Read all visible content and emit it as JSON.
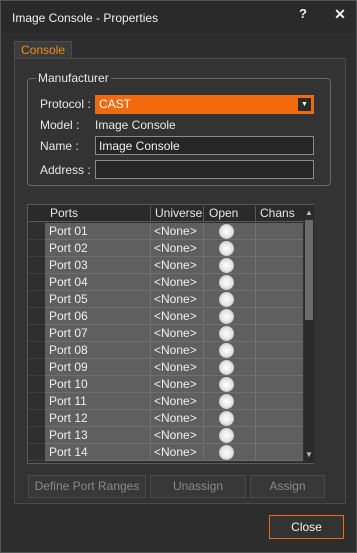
{
  "window": {
    "title": "Image Console - Properties",
    "help_label": "?",
    "close_glyph": "✕"
  },
  "tab": {
    "label": "Console"
  },
  "manufacturer": {
    "legend": "Manufacturer",
    "protocol_label": "Protocol :",
    "protocol_value": "CAST",
    "model_label": "Model :",
    "model_value": "Image Console",
    "name_label": "Name :",
    "name_value": "Image Console",
    "address_label": "Address :",
    "address_value": ""
  },
  "ports_table": {
    "headers": {
      "ports": "Ports",
      "universe": "Universe",
      "open": "Open",
      "chans": "Chans"
    },
    "rows": [
      {
        "port": "Port 01",
        "universe": "<None>",
        "chans": ""
      },
      {
        "port": "Port 02",
        "universe": "<None>",
        "chans": ""
      },
      {
        "port": "Port 03",
        "universe": "<None>",
        "chans": ""
      },
      {
        "port": "Port 04",
        "universe": "<None>",
        "chans": ""
      },
      {
        "port": "Port 05",
        "universe": "<None>",
        "chans": ""
      },
      {
        "port": "Port 06",
        "universe": "<None>",
        "chans": ""
      },
      {
        "port": "Port 07",
        "universe": "<None>",
        "chans": ""
      },
      {
        "port": "Port 08",
        "universe": "<None>",
        "chans": ""
      },
      {
        "port": "Port 09",
        "universe": "<None>",
        "chans": ""
      },
      {
        "port": "Port 10",
        "universe": "<None>",
        "chans": ""
      },
      {
        "port": "Port 11",
        "universe": "<None>",
        "chans": ""
      },
      {
        "port": "Port 12",
        "universe": "<None>",
        "chans": ""
      },
      {
        "port": "Port 13",
        "universe": "<None>",
        "chans": ""
      },
      {
        "port": "Port 14",
        "universe": "<None>",
        "chans": ""
      }
    ]
  },
  "buttons": {
    "define_port_ranges": "Define Port Ranges",
    "unassign": "Unassign",
    "assign": "Assign",
    "close": "Close"
  },
  "colors": {
    "accent": "#f26a0d",
    "tab_text": "#f28a1b",
    "background": "#2d2d2d"
  }
}
